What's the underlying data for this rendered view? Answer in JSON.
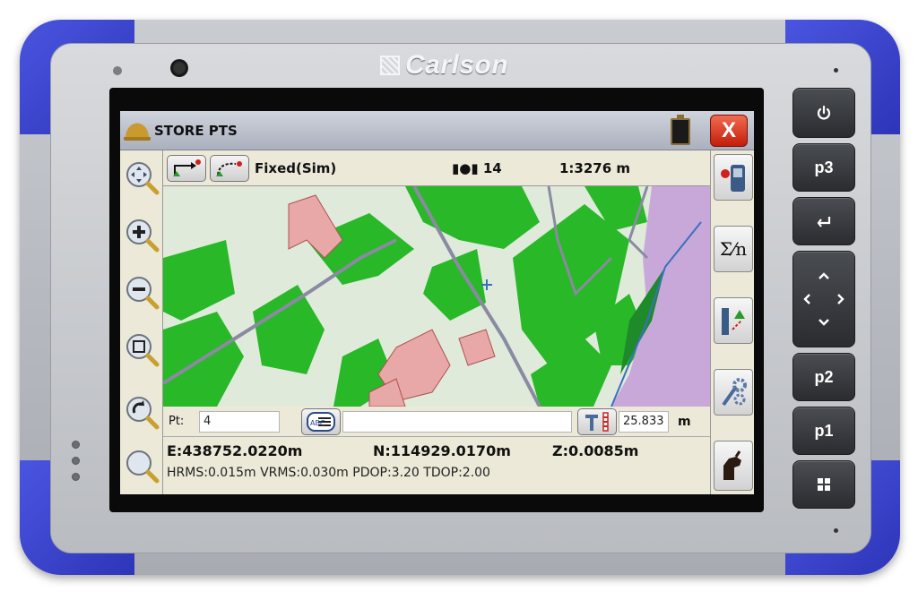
{
  "device": {
    "brand": "Carlson",
    "buttons": {
      "power_icon": "power-icon",
      "p3": "p3",
      "enter_icon": "enter-icon",
      "p2": "p2",
      "p1": "p1",
      "windows_icon": "windows-icon"
    }
  },
  "app": {
    "title": "STORE PTS",
    "close_label": "X"
  },
  "toolbar": {
    "gps_mode": "Fixed(Sim)",
    "satellites": "14",
    "scale": "1:3276 m"
  },
  "point_bar": {
    "pt_label": "Pt:",
    "pt_value": "4",
    "description_value": "",
    "rod_height": "25.833",
    "unit": "m"
  },
  "coordinates": {
    "easting": "E:438752.0220m",
    "northing": "N:114929.0170m",
    "elevation": "Z:0.0085m"
  },
  "quality": "HRMS:0.015m VRMS:0.030m PDOP:3.20 TDOP:2.00",
  "colors": {
    "bumper": "#3a44d0",
    "titlebar": "#aab0bd",
    "close": "#d9301a",
    "map_green": "#28b828",
    "map_building": "#e8a8a8",
    "map_purple": "#c8a8d8"
  }
}
